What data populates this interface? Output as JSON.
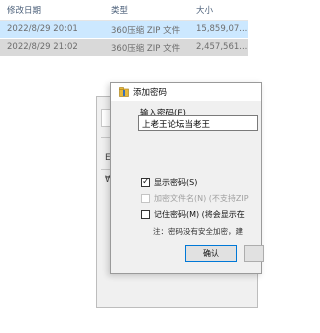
{
  "file_list": {
    "columns": {
      "date": "修改日期",
      "type": "类型",
      "size": "大小"
    },
    "rows": [
      {
        "date": "2022/8/29 20:01",
        "type": "360压缩 ZIP 文件",
        "size": "15,859,07..."
      },
      {
        "date": "2022/8/29 21:02",
        "type": "360压缩 ZIP 文件",
        "size": "2,457,561..."
      }
    ]
  },
  "underlying_dialog": {
    "glyph_a": "E",
    "glyph_b": "₩"
  },
  "dialog": {
    "title": "添加密码",
    "password_label": "输入密码(E)",
    "password_value": "上老王论坛当老王",
    "options": [
      {
        "label": "显示密码(S)",
        "checked": true,
        "enabled": true
      },
      {
        "label": "加密文件名(N) (不支持ZIP",
        "checked": false,
        "enabled": false
      },
      {
        "label": "记住密码(M) (将会显示在",
        "checked": false,
        "enabled": true
      }
    ],
    "note": "注：密码没有安全加密，建",
    "ok_label": "确认",
    "cancel_label": ""
  }
}
